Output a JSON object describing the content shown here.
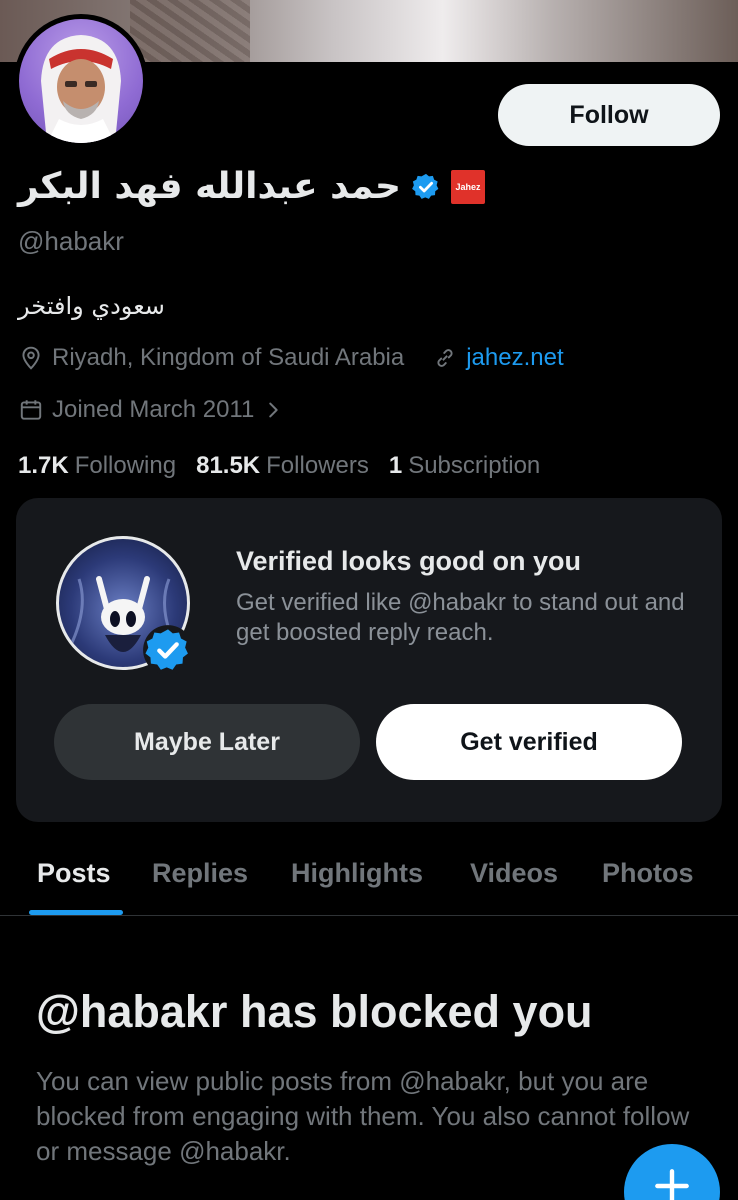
{
  "profile": {
    "display_name": "حمد عبدالله فهد البكر",
    "handle": "@habakr",
    "bio": "سعودي وافتخر",
    "affiliate_label": "Jahez",
    "location": "Riyadh, Kingdom of Saudi Arabia",
    "website": "jahez.net",
    "joined": "Joined March 2011",
    "follow_label": "Follow"
  },
  "stats": {
    "following_count": "1.7K",
    "following_label": "Following",
    "followers_count": "81.5K",
    "followers_label": "Followers",
    "subscription_count": "1",
    "subscription_label": "Subscription"
  },
  "verify_card": {
    "title": "Verified looks good on you",
    "description": "Get verified like @habakr to stand out and get boosted reply reach.",
    "later_label": "Maybe Later",
    "verify_label": "Get verified"
  },
  "tabs": [
    {
      "label": "Posts",
      "active": true
    },
    {
      "label": "Replies"
    },
    {
      "label": "Highlights"
    },
    {
      "label": "Videos"
    },
    {
      "label": "Photos"
    }
  ],
  "blocked": {
    "title": "@habakr has blocked you",
    "description": "You can view public posts from @habakr, but you are blocked from engaging with them. You also cannot follow or message @habakr."
  },
  "colors": {
    "accent": "#1d9bf0",
    "background": "#000000",
    "muted_text": "#71767b",
    "affiliate_badge": "#e0322a"
  },
  "icons": [
    "location-pin-icon",
    "link-icon",
    "calendar-icon",
    "chevron-right-icon",
    "verified-badge-icon",
    "plus-icon"
  ]
}
